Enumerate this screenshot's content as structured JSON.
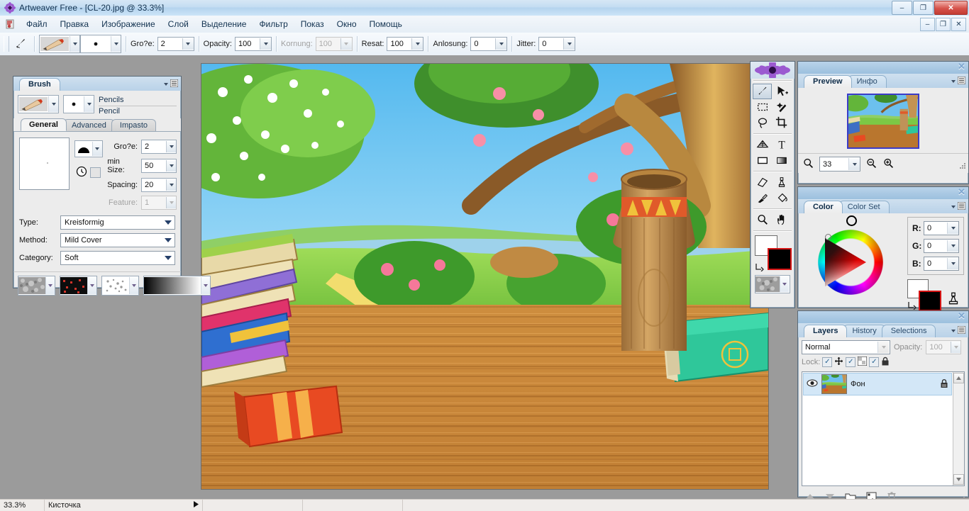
{
  "window": {
    "title": "Artweaver Free - [CL-20.jpg @ 33.3%]",
    "app_icon": "artweaver-flower-icon",
    "controls": {
      "minimize": "–",
      "maximize": "❐",
      "close": "✕"
    },
    "mdi_controls": {
      "minimize": "–",
      "restore": "❐",
      "close": "✕"
    }
  },
  "menubar": {
    "icon": "document-icon",
    "items": [
      {
        "label": "Файл"
      },
      {
        "label": "Правка"
      },
      {
        "label": "Изображение"
      },
      {
        "label": "Слой"
      },
      {
        "label": "Выделение"
      },
      {
        "label": "Фильтр"
      },
      {
        "label": "Показ"
      },
      {
        "label": "Окно"
      },
      {
        "label": "Помощь"
      }
    ]
  },
  "options_toolbar": {
    "brush_tool_icon": "paintbrush-icon",
    "brush_preset_icon": "pencil-preset-icon",
    "tip_preset_icon": "dot-tip-icon",
    "fields": [
      {
        "label": "Gro?e:",
        "value": "2",
        "disabled": false
      },
      {
        "label": "Opacity:",
        "value": "100",
        "disabled": false
      },
      {
        "label": "Kornung:",
        "value": "100",
        "disabled": true
      },
      {
        "label": "Resat:",
        "value": "100",
        "disabled": false
      },
      {
        "label": "Anlosung:",
        "value": "0",
        "disabled": false
      },
      {
        "label": "Jitter:",
        "value": "0",
        "disabled": false
      }
    ]
  },
  "brush_panel": {
    "title": "Brush",
    "preset_icon": "pencil-preset-icon",
    "tip_icon": "dot-tip-icon",
    "category_line": "Pencils",
    "variant_line": "Pencil",
    "tabs": [
      {
        "label": "General",
        "active": true
      },
      {
        "label": "Advanced",
        "active": false
      },
      {
        "label": "Impasto",
        "active": false
      }
    ],
    "shape_icon": "brush-shape-icon",
    "timing_icon": "clock-icon",
    "fields": [
      {
        "label": "Gro?e:",
        "value": "2",
        "disabled": false
      },
      {
        "label": "min Size:",
        "value": "50",
        "disabled": false
      },
      {
        "label": "Spacing:",
        "value": "20",
        "disabled": false
      },
      {
        "label": "Feature:",
        "value": "1",
        "disabled": true
      }
    ],
    "selects": [
      {
        "label": "Type:",
        "value": "Kreisformig"
      },
      {
        "label": "Method:",
        "value": "Mild Cover"
      },
      {
        "label": "Category:",
        "value": "Soft"
      }
    ],
    "swatches": [
      {
        "name": "paper-texture-swatch"
      },
      {
        "name": "pattern-swatch"
      },
      {
        "name": "scatter-swatch"
      },
      {
        "name": "gradient-swatch"
      }
    ]
  },
  "tools_palette": {
    "logo_icon": "artweaver-flower-logo",
    "tools": [
      {
        "name": "brush-tool",
        "icon": "paintbrush-icon",
        "selected": true
      },
      {
        "name": "move-tool",
        "icon": "move-arrow-icon",
        "selected": false
      },
      {
        "name": "rect-marquee-tool",
        "icon": "rectangular-marquee-icon",
        "selected": false
      },
      {
        "name": "magic-wand-tool",
        "icon": "magic-wand-icon",
        "selected": false
      },
      {
        "name": "lasso-tool",
        "icon": "lasso-icon",
        "selected": false
      },
      {
        "name": "crop-tool",
        "icon": "crop-icon",
        "selected": false
      },
      {
        "name": "mesh-tool",
        "icon": "perspective-grid-icon",
        "selected": false
      },
      {
        "name": "text-tool",
        "icon": "text-T-icon",
        "selected": false
      },
      {
        "name": "shape-tool",
        "icon": "rectangle-shape-icon",
        "selected": false
      },
      {
        "name": "gradient-tool",
        "icon": "gradient-icon",
        "selected": false
      },
      {
        "name": "eraser-tool",
        "icon": "eraser-icon",
        "selected": false
      },
      {
        "name": "clone-stamp-tool",
        "icon": "clone-stamp-icon",
        "selected": false
      },
      {
        "name": "eyedropper-tool",
        "icon": "eyedropper-icon",
        "selected": false
      },
      {
        "name": "paint-bucket-tool",
        "icon": "paint-bucket-icon",
        "selected": false
      },
      {
        "name": "zoom-tool",
        "icon": "magnifier-icon",
        "selected": false
      },
      {
        "name": "hand-tool",
        "icon": "hand-icon",
        "selected": false
      }
    ],
    "foreground_color": "#000000",
    "background_color": "#ffffff",
    "swap_icon": "swap-colors-icon",
    "texture_icon": "paper-texture-swatch"
  },
  "preview_panel": {
    "title_close": "✕",
    "tabs": [
      {
        "label": "Preview",
        "active": true
      },
      {
        "label": "Инфо",
        "active": false
      }
    ],
    "zoom_value": "33",
    "zoom_icon": "magnifier-icon",
    "zoom_out_icon": "zoom-out-icon",
    "zoom_in_icon": "zoom-in-icon",
    "menu_icon": "panel-menu-icon"
  },
  "color_panel": {
    "tabs": [
      {
        "label": "Color",
        "active": true
      },
      {
        "label": "Color Set",
        "active": false
      }
    ],
    "channels": [
      {
        "label": "R:",
        "value": "0"
      },
      {
        "label": "G:",
        "value": "0"
      },
      {
        "label": "B:",
        "value": "0"
      }
    ],
    "foreground_color": "#000000",
    "background_color": "#ffffff",
    "swap_icon": "swap-colors-icon",
    "clone_icon": "clone-color-icon",
    "wheel_icon": "hsv-color-wheel"
  },
  "layers_panel": {
    "tabs": [
      {
        "label": "Layers",
        "active": true
      },
      {
        "label": "History",
        "active": false
      },
      {
        "label": "Selections",
        "active": false
      }
    ],
    "blend_mode": "Normal",
    "opacity_label": "Opacity:",
    "opacity_value": "100",
    "lock_label": "Lock:",
    "lock_toggles": [
      {
        "name": "lock-position",
        "icon": "move-cross-icon",
        "checked": true
      },
      {
        "name": "lock-transparency",
        "icon": "checker-square-icon",
        "checked": true
      },
      {
        "name": "lock-all",
        "icon": "padlock-icon",
        "checked": true
      }
    ],
    "layers": [
      {
        "name": "Фон",
        "visible": true,
        "locked": true,
        "selected": true
      }
    ],
    "footer_buttons": [
      {
        "name": "move-layer-up-button",
        "icon": "arrow-up-icon"
      },
      {
        "name": "move-layer-down-button",
        "icon": "arrow-down-icon"
      },
      {
        "name": "new-group-button",
        "icon": "folder-icon"
      },
      {
        "name": "new-layer-button",
        "icon": "new-layer-icon"
      },
      {
        "name": "delete-layer-button",
        "icon": "trash-icon"
      }
    ]
  },
  "status_bar": {
    "zoom": "33.3%",
    "tool": "Кисточка",
    "expand_icon": "triangle-right-icon"
  },
  "canvas": {
    "document": "CL-20.jpg",
    "zoom": "33.3%",
    "description": "cartoon forest scene with stacked books, wooden floor, tree trunk and barrel"
  }
}
